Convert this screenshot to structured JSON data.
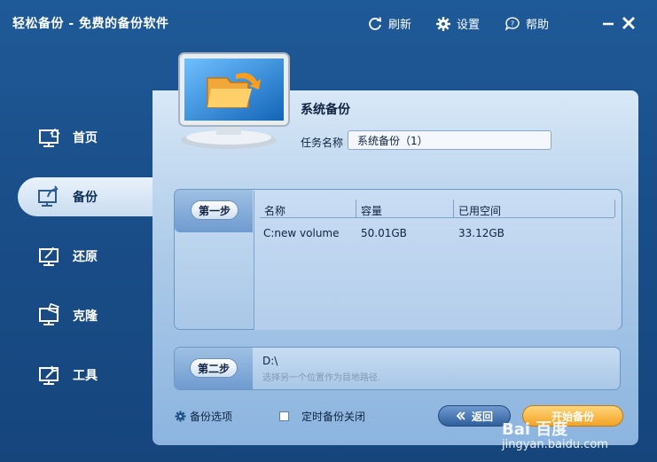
{
  "window": {
    "title": "轻松备份 - 免费的备份软件",
    "toolbar": {
      "refresh_label": "刷新",
      "settings_label": "设置",
      "help_label": "帮助"
    }
  },
  "sidebar": {
    "items": [
      {
        "label": "首页",
        "icon": "home-monitor-icon",
        "active": false
      },
      {
        "label": "备份",
        "icon": "backup-monitor-icon",
        "active": true
      },
      {
        "label": "还原",
        "icon": "restore-monitor-icon",
        "active": false
      },
      {
        "label": "克隆",
        "icon": "clone-monitor-icon",
        "active": false
      },
      {
        "label": "工具",
        "icon": "tools-monitor-icon",
        "active": false
      }
    ]
  },
  "main": {
    "section_title": "系统备份",
    "task_name_label": "任务名称",
    "task_name_value": "系统备份（1）",
    "step1": {
      "label": "第一步",
      "columns": [
        "名称",
        "容量",
        "已用空间"
      ],
      "rows": [
        {
          "name": "C:new volume",
          "capacity": "50.01GB",
          "used": "33.12GB"
        }
      ]
    },
    "step2": {
      "label": "第二步",
      "path": "D:\\",
      "hint": "选择另一个位置作为目地路径."
    }
  },
  "footer": {
    "backup_options_label": "备份选项",
    "schedule_label": "定时备份关闭",
    "back_label": "返回",
    "start_label": "开始备份"
  },
  "watermark": {
    "brand": "Bai 百度",
    "url": "jingyan.baidu.com"
  },
  "colors": {
    "window_bg": "#1a4f8a",
    "panel_bg": "#b9d3ee",
    "start_button": "#f2a326",
    "back_button": "#2f5f9c"
  }
}
